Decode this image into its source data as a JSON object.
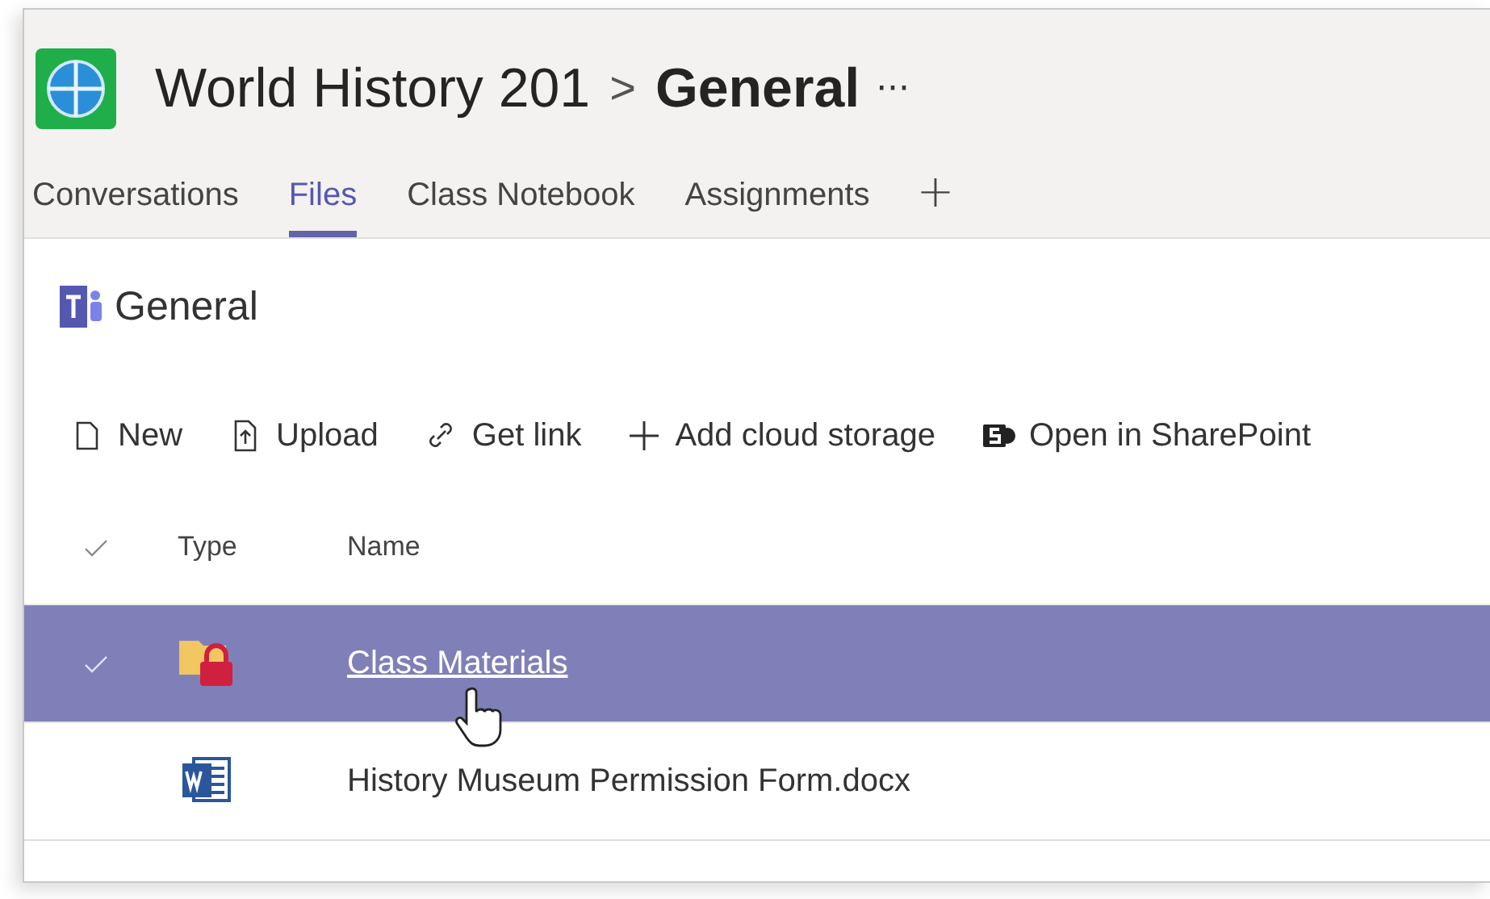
{
  "header": {
    "team": "World History 201",
    "separator": ">",
    "channel": "General",
    "more": "···"
  },
  "tabs": [
    {
      "label": "Conversations",
      "selected": false
    },
    {
      "label": "Files",
      "selected": true
    },
    {
      "label": "Class Notebook",
      "selected": false
    },
    {
      "label": "Assignments",
      "selected": false
    }
  ],
  "add_tab": "+",
  "channel_title": "General",
  "toolbar": [
    {
      "kind": "new",
      "label": "New"
    },
    {
      "kind": "upload",
      "label": "Upload"
    },
    {
      "kind": "link",
      "label": "Get link"
    },
    {
      "kind": "add",
      "label": "Add cloud storage"
    },
    {
      "kind": "sharepoint",
      "label": "Open in SharePoint"
    }
  ],
  "table": {
    "columns": [
      "Type",
      "Name"
    ],
    "rows": [
      {
        "kind": "folder-locked",
        "name": "Class Materials",
        "selected": true,
        "hovered": true
      },
      {
        "kind": "word",
        "name": "History Museum Permission Form.docx",
        "selected": false,
        "hovered": false
      }
    ]
  }
}
